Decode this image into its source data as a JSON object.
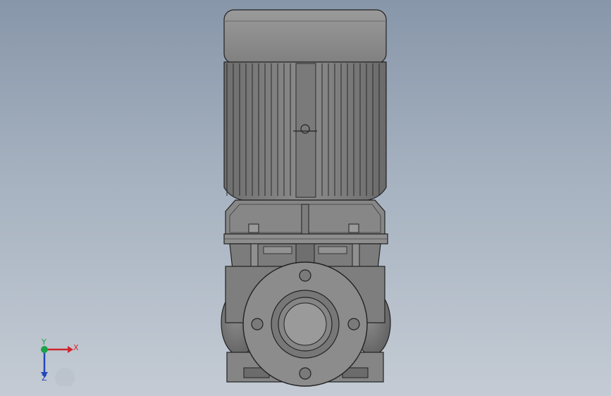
{
  "viewport": {
    "background_top": "#8796a9",
    "background_bottom": "#c4cbd4",
    "model": "vertical-inline-pump",
    "view": "front"
  },
  "triad": {
    "x_label": "X",
    "y_label": "Y",
    "z_label": "Z",
    "x_color": "#d0262e",
    "y_color": "#1aa34a",
    "z_color": "#2446b8"
  }
}
